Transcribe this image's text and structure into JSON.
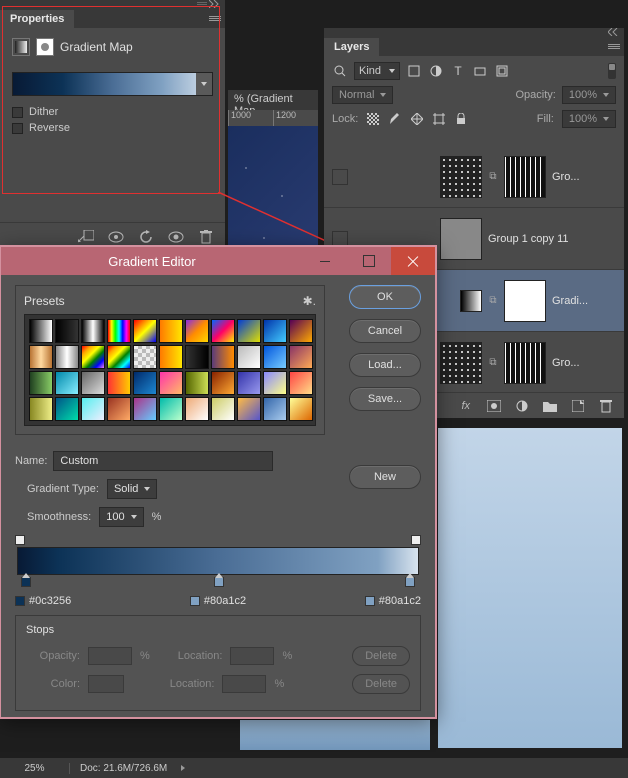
{
  "doc": {
    "title": "% (Gradient Map",
    "ruler_ticks": [
      "1000",
      "1200"
    ]
  },
  "status": {
    "zoom": "25%",
    "doc_info": "Doc: 21.6M/726.6M"
  },
  "properties": {
    "tab": "Properties",
    "title": "Gradient Map",
    "dither": "Dither",
    "reverse": "Reverse"
  },
  "layers": {
    "tab": "Layers",
    "kind": "Kind",
    "blend": "Normal",
    "opacity_label": "Opacity:",
    "opacity_val": "100%",
    "lock_label": "Lock:",
    "fill_label": "Fill:",
    "fill_val": "100%",
    "rows": [
      {
        "name": "Gro..."
      },
      {
        "name": "Group 1 copy 11"
      },
      {
        "name": "Gradi..."
      },
      {
        "name": "Gro..."
      }
    ],
    "fx": "fx"
  },
  "gradient_editor": {
    "title": "Gradient Editor",
    "presets_title": "Presets",
    "buttons": {
      "ok": "OK",
      "cancel": "Cancel",
      "load": "Load...",
      "save": "Save...",
      "new": "New"
    },
    "name_label": "Name:",
    "name_value": "Custom",
    "type_label": "Gradient Type:",
    "type_value": "Solid",
    "smooth_label": "Smoothness:",
    "smooth_value": "100",
    "smooth_pct": "%",
    "stop_labels": [
      "#0c3256",
      "#80a1c2",
      "#80a1c2"
    ],
    "stops_title": "Stops",
    "opacity_label": "Opacity:",
    "location_label": "Location:",
    "color_label": "Color:",
    "pct": "%",
    "delete": "Delete"
  },
  "presets": [
    "linear-gradient(90deg,#000,#fff)",
    "linear-gradient(90deg,#000,transparent)",
    "linear-gradient(90deg,#000,#fff,#000)",
    "linear-gradient(90deg,red,yellow,lime,cyan,blue,magenta,red)",
    "linear-gradient(135deg,red,yellow,blue)",
    "linear-gradient(90deg,#ff7a00,#ffe600)",
    "linear-gradient(135deg,#8a2be2,#ff8c00,#ffd700)",
    "linear-gradient(135deg,#0066ff,#ff0066,#ffee00)",
    "linear-gradient(135deg,#003cd6,#e0e000)",
    "linear-gradient(135deg,#0033aa,#44ccff)",
    "linear-gradient(135deg,#550055,#ffaa00)",
    "linear-gradient(90deg,#b87333,#ffd9a0,#b87333)",
    "linear-gradient(90deg,#888,#fff,#888)",
    "linear-gradient(135deg,red,orange,yellow,green,blue,violet)",
    "linear-gradient(135deg,red,orange,yellow,green,cyan,blue)",
    "repeating-conic-gradient(#bbb 0 25%,#eee 0 50%) 0/8px 8px",
    "linear-gradient(90deg,#ff7a00,#ffe600)",
    "linear-gradient(90deg,transparent,#000)",
    "linear-gradient(90deg,#5a3b7a,#ff8c00)",
    "linear-gradient(135deg,#bbb,#fff)",
    "linear-gradient(135deg,#0055dd,#77ccff)",
    "linear-gradient(135deg,#883366,#ffaa55)",
    "linear-gradient(90deg,#204020,#88cc66)",
    "linear-gradient(135deg,#0088aa,#88eeff)",
    "linear-gradient(135deg,#666,#ddd)",
    "linear-gradient(90deg,#ff3333,#ffcc00)",
    "linear-gradient(135deg,#002a6b,#1d87d1)",
    "linear-gradient(135deg,#ff33aa,#ffbb66)",
    "linear-gradient(90deg,#556600,#ccdd55)",
    "linear-gradient(135deg,#882200,#ffaa33)",
    "linear-gradient(135deg,#3333aa,#9999ee)",
    "linear-gradient(135deg,#8888ff,#ffff88)",
    "linear-gradient(135deg,#ff4444,#ffdd88)",
    "linear-gradient(90deg,#888822,#eeee88)",
    "linear-gradient(135deg,#005588,#00ddaa)",
    "linear-gradient(135deg,#55eeee,#eef)",
    "linear-gradient(135deg,#993322,#ffaa66)",
    "linear-gradient(135deg,#aa3388,#66ccff)",
    "linear-gradient(135deg,#00bbaa,#bbffcc)",
    "linear-gradient(135deg,#eeaa77,#fff)",
    "linear-gradient(135deg,#cccc66,#fff)",
    "linear-gradient(135deg,#ffbb44,#5555cc)",
    "linear-gradient(135deg,#3366aa,#aaccee)",
    "linear-gradient(135deg,#ffff99,#dd6600)"
  ]
}
